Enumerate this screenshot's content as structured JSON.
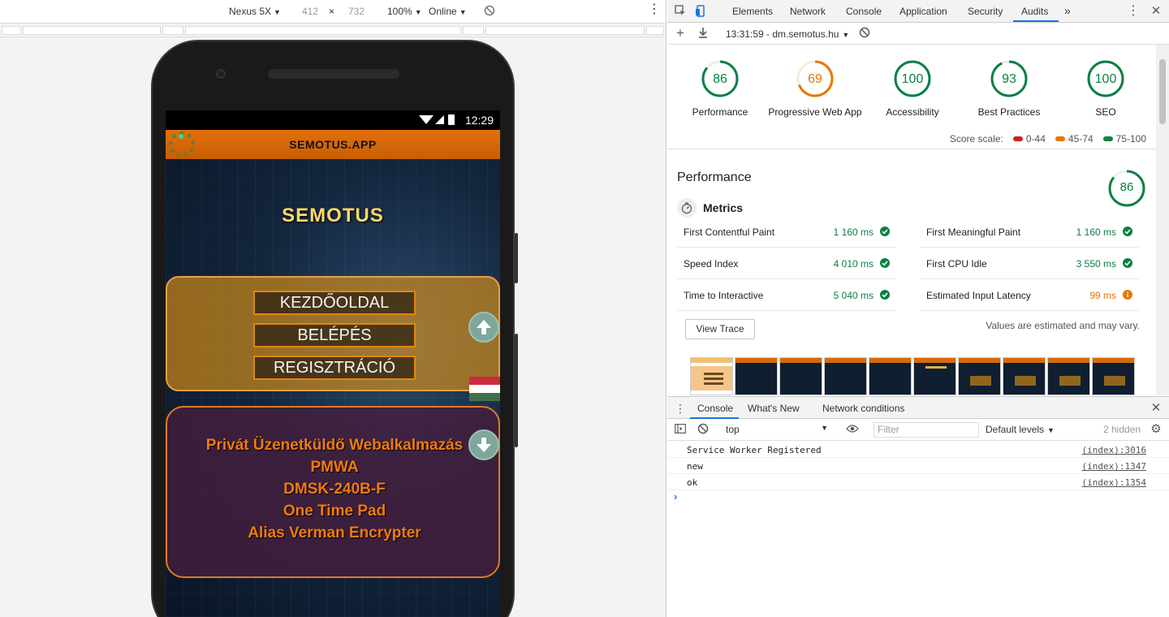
{
  "device_toolbar": {
    "device": "Nexus 5X",
    "width": "412",
    "times": "×",
    "height": "732",
    "zoom": "100%",
    "network": "Online"
  },
  "phone": {
    "time": "12:29",
    "header_title": "SEMOTUS.APP",
    "brand": "SEMOTUS",
    "nav": [
      "KEZDŐOLDAL",
      "BELÉPÉS",
      "REGISZTRÁCIÓ"
    ],
    "info_lines": [
      "Privát Üzenetküldő Webalkalmazás",
      "PMWA",
      "DMSK-240B-F",
      "One Time Pad",
      "Alias Verman Encrypter"
    ]
  },
  "devtools": {
    "tabs": [
      "Elements",
      "Network",
      "Console",
      "Application",
      "Security",
      "Audits"
    ],
    "active_tab": "Audits",
    "more": "»",
    "audit_run": "13:31:59 - dm.semotus.hu",
    "scores": [
      {
        "label": "Performance",
        "value": "86",
        "color": "#0b8043",
        "fraction": 0.86
      },
      {
        "label": "Progressive Web App",
        "value": "69",
        "color": "#e67700",
        "fraction": 0.69
      },
      {
        "label": "Accessibility",
        "value": "100",
        "color": "#0b8043",
        "fraction": 1.0
      },
      {
        "label": "Best Practices",
        "value": "93",
        "color": "#0b8043",
        "fraction": 0.93
      },
      {
        "label": "SEO",
        "value": "100",
        "color": "#0b8043",
        "fraction": 1.0
      }
    ],
    "score_scale": {
      "label": "Score scale:",
      "ranges": [
        {
          "text": "0-44",
          "color": "#c7221f"
        },
        {
          "text": "45-74",
          "color": "#e67700"
        },
        {
          "text": "75-100",
          "color": "#178239"
        }
      ]
    },
    "performance": {
      "title": "Performance",
      "score": "86",
      "score_fraction": 0.86,
      "metrics_title": "Metrics",
      "metrics": [
        {
          "name": "First Contentful Paint",
          "value": "1 160 ms",
          "status": "pass"
        },
        {
          "name": "First Meaningful Paint",
          "value": "1 160 ms",
          "status": "pass"
        },
        {
          "name": "Speed Index",
          "value": "4 010 ms",
          "status": "pass"
        },
        {
          "name": "First CPU Idle",
          "value": "3 550 ms",
          "status": "pass"
        },
        {
          "name": "Time to Interactive",
          "value": "5 040 ms",
          "status": "pass"
        },
        {
          "name": "Estimated Input Latency",
          "value": "99 ms",
          "status": "average"
        }
      ],
      "view_trace": "View Trace",
      "note": "Values are estimated and may vary."
    },
    "drawer": {
      "tabs": [
        "Console",
        "What's New",
        "Network conditions"
      ],
      "context": "top",
      "filter_placeholder": "Filter",
      "levels": "Default levels",
      "hidden": "2 hidden",
      "logs": [
        {
          "msg": "Service Worker Registered",
          "src": "(index):3016"
        },
        {
          "msg": "new",
          "src": "(index):1347"
        },
        {
          "msg": "ok",
          "src": "(index):1354"
        }
      ]
    }
  }
}
